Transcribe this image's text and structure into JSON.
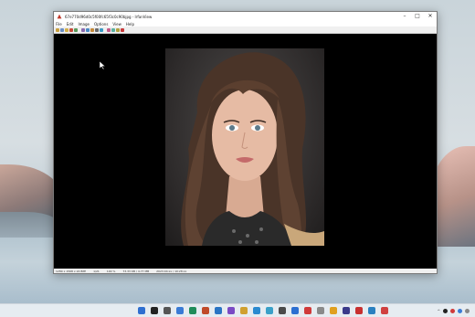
{
  "window": {
    "title": "67e770d96d0c5f00fc65f3c0c90bjpg - IrfanView",
    "minimize": "–",
    "maximize": "□",
    "close": "✕"
  },
  "menu": [
    "File",
    "Edit",
    "Image",
    "Options",
    "View",
    "Help"
  ],
  "toolbar_colors": [
    "#c8a040",
    "#6a8fc4",
    "#d4b04a",
    "#c84a3a",
    "#5a9a5a",
    "#8a6ab0",
    "#4a8ac4",
    "#c48a3a",
    "#6a6a6a",
    "#3a9ac4",
    "#c45a8a",
    "#5ab0a0",
    "#b0a040",
    "#c83a3a"
  ],
  "status": {
    "dims": "1280 x 1568 x 24 BPP",
    "index": "1/21",
    "zoom": "100 %",
    "size": "73.33 KB / 4.77 MB",
    "date": "2023:04:xx / 10:28:xx"
  },
  "taskbar_icon_colors": [
    "#2f6fd0",
    "#222222",
    "#555555",
    "#3a7bd5",
    "#1f8c5a",
    "#c04a2a",
    "#2a74c4",
    "#7a4ac4",
    "#d0a030",
    "#2a8ad0",
    "#3aa0c8",
    "#4a4a4a",
    "#2c6fd1",
    "#d03a3a",
    "#8a8a8a",
    "#e0a020",
    "#3a3a8a",
    "#c83030",
    "#2a80c0",
    "#d04040"
  ],
  "tray": {
    "time_hint": ""
  }
}
